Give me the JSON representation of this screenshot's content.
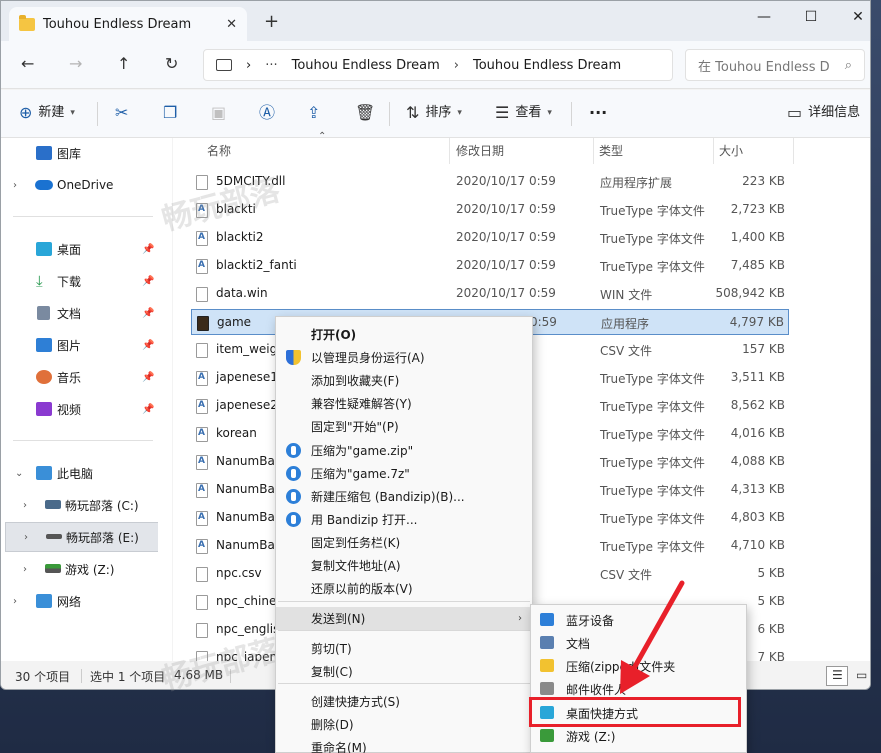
{
  "window": {
    "tab_title": "Touhou Endless Dream",
    "tab_close": "✕",
    "new_tab": "+",
    "minimize": "—",
    "maximize": "☐",
    "close": "✕"
  },
  "nav": {
    "back": "←",
    "forward": "→",
    "up": "↑",
    "refresh": "↻",
    "address_more": "···",
    "breadcrumb": [
      "Touhou Endless Dream",
      "Touhou Endless Dream"
    ],
    "search_placeholder": "在 Touhou Endless D",
    "search_icon": "⌕"
  },
  "commandbar": {
    "new_label": "新建",
    "sort_label": "排序",
    "view_label": "查看",
    "more": "···",
    "details_label": "详细信息"
  },
  "sidebar": {
    "items": [
      {
        "label": "图库",
        "icon": "gallery-icon"
      },
      {
        "label": "OneDrive",
        "icon": "onedrive-icon"
      },
      {
        "label": "桌面",
        "icon": "desktop-icon"
      },
      {
        "label": "下载",
        "icon": "download-icon"
      },
      {
        "label": "文档",
        "icon": "documents-icon"
      },
      {
        "label": "图片",
        "icon": "pictures-icon"
      },
      {
        "label": "音乐",
        "icon": "music-icon"
      },
      {
        "label": "视频",
        "icon": "videos-icon"
      },
      {
        "label": "此电脑",
        "icon": "pc-icon"
      },
      {
        "label": "畅玩部落 (C:)",
        "icon": "drive-icon"
      },
      {
        "label": "畅玩部落 (E:)",
        "icon": "drive-icon"
      },
      {
        "label": "游戏 (Z:)",
        "icon": "drive-icon"
      },
      {
        "label": "网络",
        "icon": "network-icon"
      }
    ]
  },
  "columns": {
    "name": "名称",
    "date": "修改日期",
    "type": "类型",
    "size": "大小"
  },
  "files": [
    {
      "name": "5DMCITY.dll",
      "date": "2020/10/17 0:59",
      "type": "应用程序扩展",
      "size": "223 KB",
      "icon": "file"
    },
    {
      "name": "blackti",
      "date": "2020/10/17 0:59",
      "type": "TrueType 字体文件",
      "size": "2,723 KB",
      "icon": "font"
    },
    {
      "name": "blackti2",
      "date": "2020/10/17 0:59",
      "type": "TrueType 字体文件",
      "size": "1,400 KB",
      "icon": "font"
    },
    {
      "name": "blackti2_fanti",
      "date": "2020/10/17 0:59",
      "type": "TrueType 字体文件",
      "size": "7,485 KB",
      "icon": "font"
    },
    {
      "name": "data.win",
      "date": "2020/10/17 0:59",
      "type": "WIN 文件",
      "size": "508,942 KB",
      "icon": "file"
    },
    {
      "name": "game",
      "date": "2020/10/17 0:59",
      "type": "应用程序",
      "size": "4,797 KB",
      "icon": "exe"
    },
    {
      "name": "item_weigh",
      "date": "59",
      "type": "CSV 文件",
      "size": "157 KB",
      "icon": "file"
    },
    {
      "name": "japenese1",
      "date": "59",
      "type": "TrueType 字体文件",
      "size": "3,511 KB",
      "icon": "font"
    },
    {
      "name": "japenese2",
      "date": "59",
      "type": "TrueType 字体文件",
      "size": "8,562 KB",
      "icon": "font"
    },
    {
      "name": "korean",
      "date": "59",
      "type": "TrueType 字体文件",
      "size": "4,016 KB",
      "icon": "font"
    },
    {
      "name": "NanumBar",
      "date": "59",
      "type": "TrueType 字体文件",
      "size": "4,088 KB",
      "icon": "font"
    },
    {
      "name": "NanumBar",
      "date": "59",
      "type": "TrueType 字体文件",
      "size": "4,313 KB",
      "icon": "font"
    },
    {
      "name": "NanumBar",
      "date": "59",
      "type": "TrueType 字体文件",
      "size": "4,803 KB",
      "icon": "font"
    },
    {
      "name": "NanumBar",
      "date": "59",
      "type": "TrueType 字体文件",
      "size": "4,710 KB",
      "icon": "font"
    },
    {
      "name": "npc.csv",
      "date": "59",
      "type": "CSV 文件",
      "size": "5 KB",
      "icon": "file"
    },
    {
      "name": "npc_chines",
      "date": "",
      "type": "",
      "size": "5 KB",
      "icon": "file"
    },
    {
      "name": "npc_englis",
      "date": "",
      "type": "",
      "size": "6 KB",
      "icon": "file"
    },
    {
      "name": "npc_japen",
      "date": "",
      "type": "",
      "size": "7 KB",
      "icon": "file"
    }
  ],
  "status": {
    "count": "30 个项目",
    "selected": "选中 1 个项目",
    "size": "4.68 MB"
  },
  "context_menu": {
    "items": [
      {
        "label": "打开(O)",
        "icon": "",
        "bold": true
      },
      {
        "label": "以管理员身份运行(A)",
        "icon": "shield"
      },
      {
        "label": "添加到收藏夹(F)",
        "icon": ""
      },
      {
        "label": "兼容性疑难解答(Y)",
        "icon": ""
      },
      {
        "label": "固定到\"开始\"(P)",
        "icon": ""
      },
      {
        "label": "压缩为\"game.zip\"",
        "icon": "bandizip"
      },
      {
        "label": "压缩为\"game.7z\"",
        "icon": "bandizip"
      },
      {
        "label": "新建压缩包 (Bandizip)(B)...",
        "icon": "bandizip"
      },
      {
        "label": "用 Bandizip 打开...",
        "icon": "bandizip"
      },
      {
        "label": "固定到任务栏(K)",
        "icon": ""
      },
      {
        "label": "复制文件地址(A)",
        "icon": ""
      },
      {
        "label": "还原以前的版本(V)",
        "icon": ""
      },
      {
        "label": "发送到(N)",
        "icon": "",
        "arrow": "›"
      },
      {
        "label": "剪切(T)",
        "icon": ""
      },
      {
        "label": "复制(C)",
        "icon": ""
      },
      {
        "label": "创建快捷方式(S)",
        "icon": ""
      },
      {
        "label": "删除(D)",
        "icon": ""
      },
      {
        "label": "重命名(M)",
        "icon": ""
      }
    ]
  },
  "sendto_menu": {
    "items": [
      {
        "label": "蓝牙设备",
        "icon": "bluetooth-icon",
        "color": "#2d7fd8"
      },
      {
        "label": "文档",
        "icon": "documents-icon",
        "color": "#5a7fb0"
      },
      {
        "label": "压缩(zipped)文件夹",
        "icon": "zip-folder-icon",
        "color": "#f2c230"
      },
      {
        "label": "邮件收件人",
        "icon": "mail-icon",
        "color": "#8a8a8a"
      },
      {
        "label": "桌面快捷方式",
        "icon": "desktop-icon",
        "color": "#29a6d8"
      },
      {
        "label": "游戏 (Z:)",
        "icon": "drive-icon",
        "color": "#3a9a3a"
      }
    ]
  },
  "colors": {
    "highlight_red": "#e8202a",
    "selection_blue": "#cfe3f7",
    "accent": "#1f5fa8"
  }
}
